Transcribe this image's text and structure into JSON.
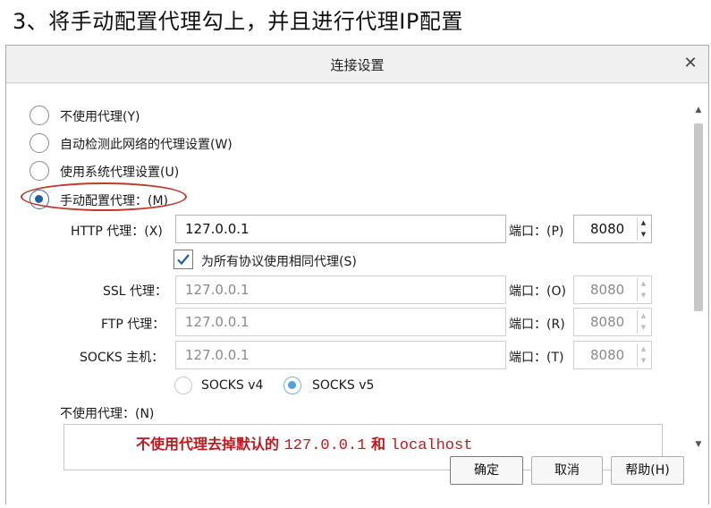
{
  "heading": "3、将手动配置代理勾上，并且进行代理IP配置",
  "dialog": {
    "title": "连接设置",
    "close": "✕"
  },
  "options": {
    "no_proxy": "不使用代理(Y)",
    "auto_detect": "自动检测此网络的代理设置(W)",
    "system_proxy": "使用系统代理设置(U)",
    "manual": "手动配置代理：(M)",
    "selected": "manual"
  },
  "http": {
    "label": "HTTP 代理：(X)",
    "value": "127.0.0.1",
    "port_label": "端口：(P)",
    "port": "8080"
  },
  "same_proxy": {
    "label": "为所有协议使用相同代理(S)",
    "checked": true
  },
  "ssl": {
    "label": "SSL 代理：",
    "value": "127.0.0.1",
    "port_label": "端口：(O)",
    "port": "8080"
  },
  "ftp": {
    "label": "FTP 代理：",
    "value": "127.0.0.1",
    "port_label": "端口：(R)",
    "port": "8080"
  },
  "socks": {
    "label": "SOCKS 主机：",
    "value": "127.0.0.1",
    "port_label": "端口：(T)",
    "port": "8080",
    "v4": "SOCKS v4",
    "v5": "SOCKS v5",
    "selected": "v5"
  },
  "no_proxy_for": {
    "label": "不使用代理：(N)",
    "annotation_cn": "不使用代理去掉默认的",
    "annotation_ip": "127.0.0.1",
    "annotation_and": "和",
    "annotation_host": "localhost"
  },
  "buttons": {
    "ok": "确定",
    "cancel": "取消",
    "help": "帮助(H)"
  },
  "colors": {
    "annotation": "#c4171d",
    "radio_selected": "#1f5fa8"
  }
}
